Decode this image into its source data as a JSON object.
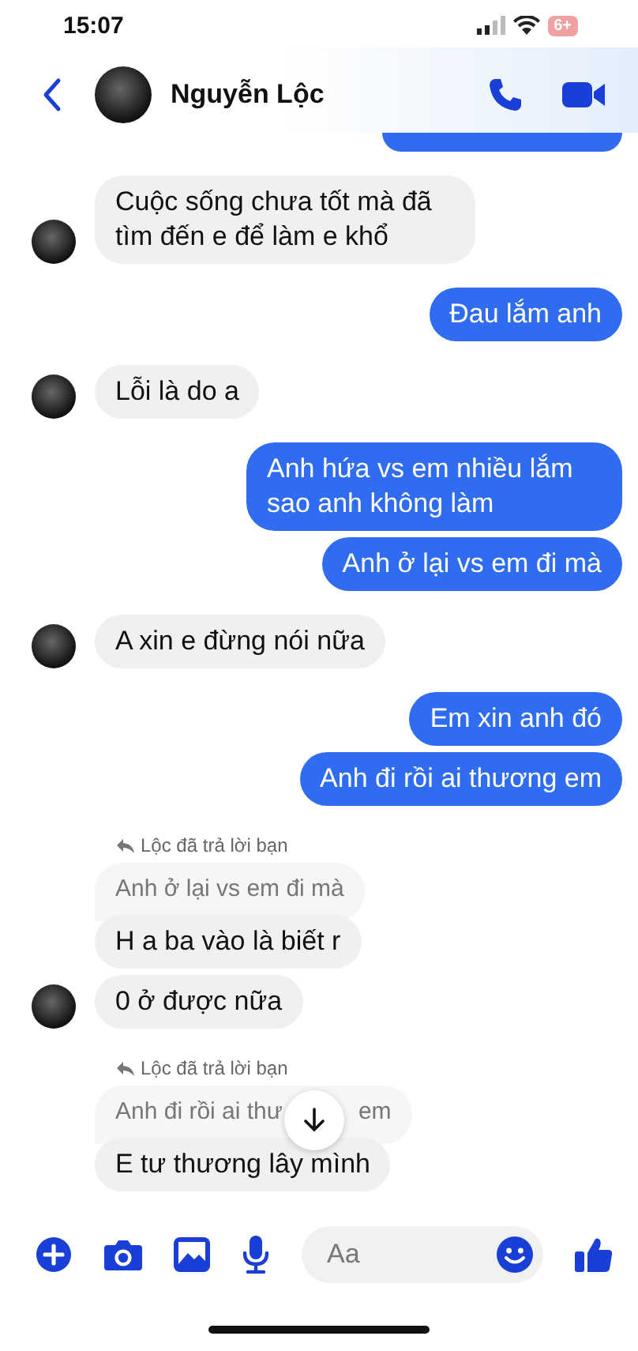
{
  "status_bar": {
    "time": "15:07",
    "battery": "6+"
  },
  "header": {
    "name": "Nguyễn Lộc"
  },
  "messages": [
    {
      "kind": "clipped"
    },
    {
      "kind": "incoming",
      "text": "Cuộc sống chưa tốt mà đã tìm đến e để làm e khổ",
      "avatar": true
    },
    {
      "kind": "outgoing",
      "text": "Đau lắm anh"
    },
    {
      "kind": "incoming",
      "text": "Lỗi là do a",
      "avatar": true
    },
    {
      "kind": "outgoing",
      "text": "Anh hứa vs em nhiều lắm sao anh không làm"
    },
    {
      "kind": "outgoing",
      "text": "Anh ở lại vs em đi mà"
    },
    {
      "kind": "incoming",
      "text": "A xin e đừng nói nữa",
      "avatar": true
    },
    {
      "kind": "outgoing",
      "text": "Em xin anh đó"
    },
    {
      "kind": "outgoing",
      "text": "Anh đi rồi ai thương em"
    },
    {
      "kind": "incoming",
      "text": "H a ba vào là biết r",
      "avatar": false,
      "reply": {
        "label": "Lộc đã trả lời bạn",
        "quote": "Anh ở lại vs em đi mà"
      }
    },
    {
      "kind": "incoming",
      "text": "0 ở được nữa",
      "avatar": true
    },
    {
      "kind": "incoming",
      "text": "E tư thương lây mình",
      "avatar": false,
      "reply": {
        "label": "Lộc đã trả lời bạn",
        "quote": "Anh đi rồi ai thư",
        "quote_tail": "em"
      }
    }
  ],
  "composer": {
    "placeholder": "Aa"
  }
}
